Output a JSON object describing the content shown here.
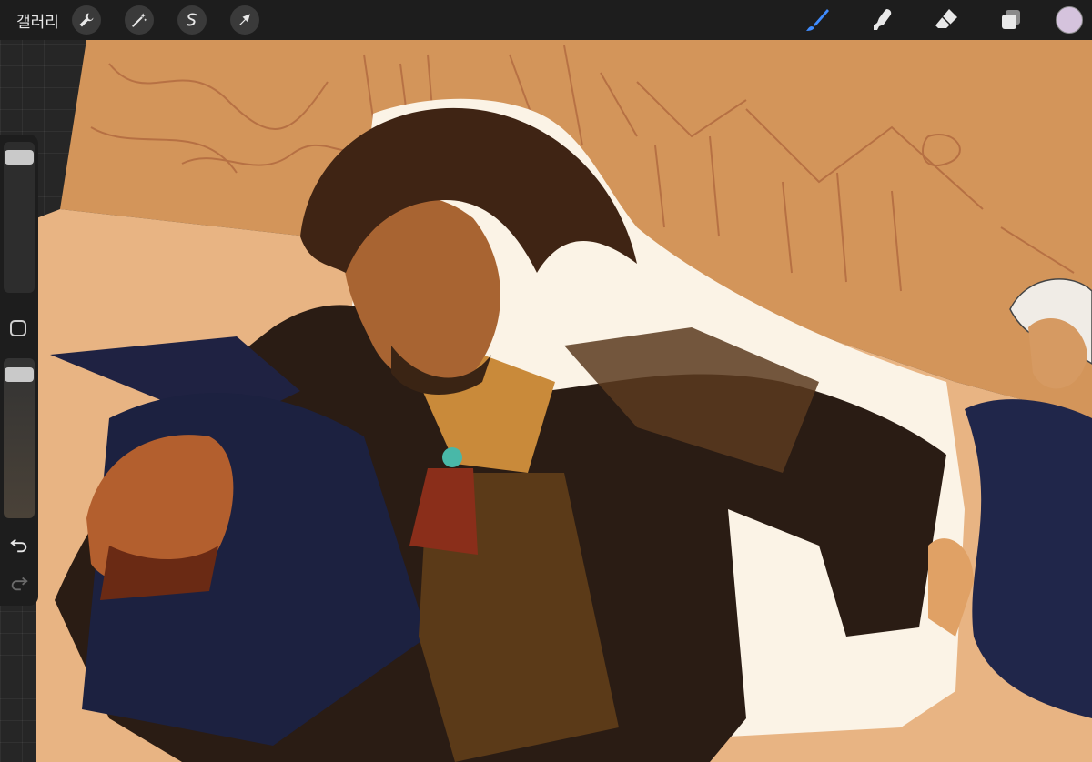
{
  "app": {
    "gallery_label": "갤러리"
  },
  "toolbar_left": [
    {
      "name": "actions-button",
      "icon": "wrench-icon"
    },
    {
      "name": "adjustments-button",
      "icon": "magic-wand-icon"
    },
    {
      "name": "selection-button",
      "icon": "selection-s-icon"
    },
    {
      "name": "transform-button",
      "icon": "arrow-cursor-icon"
    }
  ],
  "toolbar_right": [
    {
      "name": "brush-tool-button",
      "icon": "brush-icon",
      "active": true
    },
    {
      "name": "smudge-tool-button",
      "icon": "smudge-finger-icon",
      "active": false
    },
    {
      "name": "eraser-tool-button",
      "icon": "eraser-icon",
      "active": false
    },
    {
      "name": "layers-button",
      "icon": "layers-icon",
      "active": false
    }
  ],
  "current_color": "#d5c3dd",
  "accent_color": "#3f8cff",
  "sidebar": {
    "brush_size_level": 0.95,
    "opacity_level": 0.95
  },
  "artwork": {
    "description_colors": [
      "#d99a5f",
      "#e8b483",
      "#1c2140",
      "#3a2414"
    ]
  }
}
